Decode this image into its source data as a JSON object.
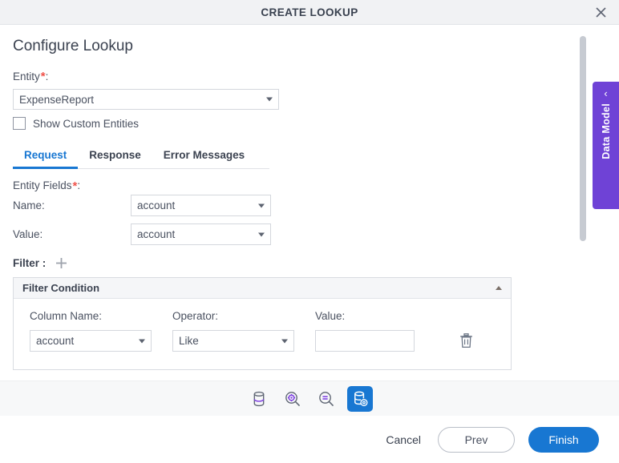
{
  "titlebar": {
    "title": "CREATE LOOKUP",
    "close_icon": "close-icon"
  },
  "page": {
    "title": "Configure Lookup"
  },
  "entity": {
    "label": "Entity",
    "required_marker": "*",
    "colon": ":",
    "value": "ExpenseReport",
    "checkbox_label": "Show Custom Entities",
    "checked": false
  },
  "tabs": [
    {
      "label": "Request",
      "active": true
    },
    {
      "label": "Response",
      "active": false
    },
    {
      "label": "Error Messages",
      "active": false
    }
  ],
  "entity_fields": {
    "header": "Entity Fields",
    "required_marker": "*",
    "colon": ":",
    "rows": [
      {
        "label": "Name:",
        "value": "account"
      },
      {
        "label": "Value:",
        "value": "account"
      }
    ]
  },
  "filter": {
    "label": "Filter :",
    "add_icon": "plus-icon",
    "panel_title": "Filter Condition",
    "collapse_icon": "chevron-up-icon",
    "columns": {
      "column_name": "Column Name:",
      "operator": "Operator:",
      "value": "Value:"
    },
    "condition": {
      "column_name": "account",
      "operator": "Like",
      "value": "",
      "value_placeholder": "",
      "delete_icon": "trash-icon"
    }
  },
  "data_model_tab": {
    "label": "Data Model",
    "chevron": "‹"
  },
  "toolbar": {
    "buttons": [
      {
        "name": "database-icon",
        "active": false
      },
      {
        "name": "search-gear-icon",
        "active": false
      },
      {
        "name": "search-minus-icon",
        "active": false
      },
      {
        "name": "database-gear-icon",
        "active": true
      }
    ]
  },
  "footer": {
    "cancel": "Cancel",
    "prev": "Prev",
    "finish": "Finish"
  },
  "colors": {
    "accent_blue": "#1877d2",
    "purple": "#6f42d6",
    "required_red": "#f0544c",
    "title_bar_bg": "#f1f2f4"
  }
}
